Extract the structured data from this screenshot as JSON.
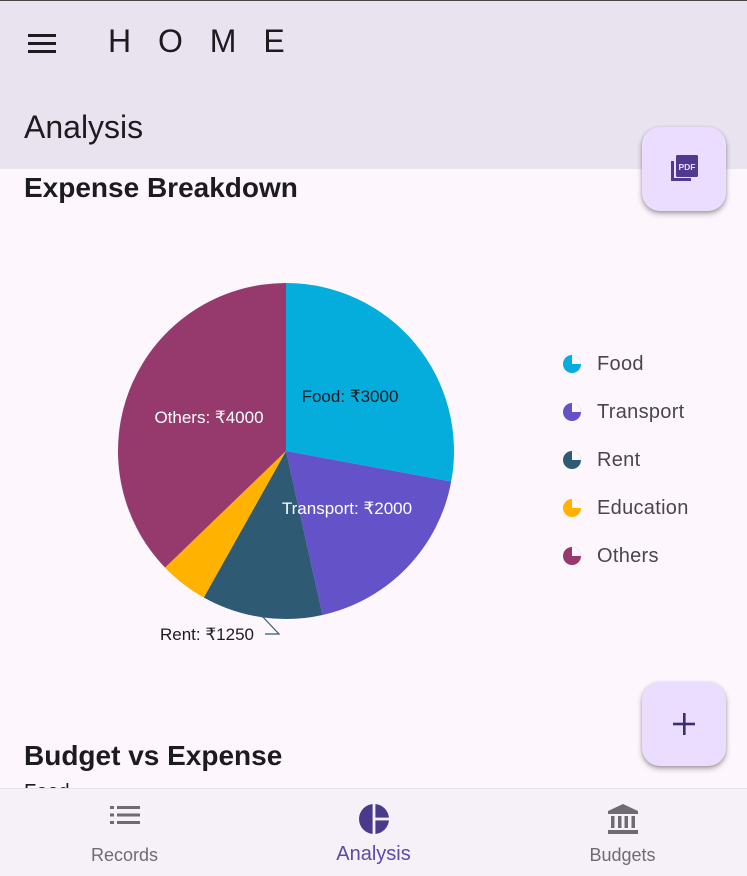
{
  "app_bar": {
    "title": "H O M E",
    "section": "Analysis"
  },
  "expense_heading": "Expense Breakdown",
  "budget_heading": "Budget vs Expense",
  "cut_off_text": "Food",
  "fab": {
    "pdf_icon": "pdf-icon",
    "add_icon": "plus-icon"
  },
  "chart_data": {
    "type": "pie",
    "title": "",
    "categories": [
      "Food",
      "Transport",
      "Rent",
      "Education",
      "Others"
    ],
    "values": [
      3000,
      2000,
      1250,
      500,
      4000
    ],
    "colors": [
      "#05addd",
      "#6452c8",
      "#2f5a73",
      "#ffb300",
      "#963a6e"
    ],
    "labels": [
      "Food: ₹3000",
      "Transport: ₹2000",
      "Rent: ₹1250",
      "",
      "Others: ₹4000"
    ],
    "legend_placement": "right"
  },
  "legend": [
    {
      "label": "Food",
      "color": "#05addd"
    },
    {
      "label": "Transport",
      "color": "#6452c8"
    },
    {
      "label": "Rent",
      "color": "#2f5a73"
    },
    {
      "label": "Education",
      "color": "#ffb300"
    },
    {
      "label": "Others",
      "color": "#963a6e"
    }
  ],
  "bottom_nav": [
    {
      "label": "Records",
      "icon": "list-icon",
      "selected": false
    },
    {
      "label": "Analysis",
      "icon": "pie-chart-icon",
      "selected": true
    },
    {
      "label": "Budgets",
      "icon": "bank-icon",
      "selected": false
    }
  ]
}
